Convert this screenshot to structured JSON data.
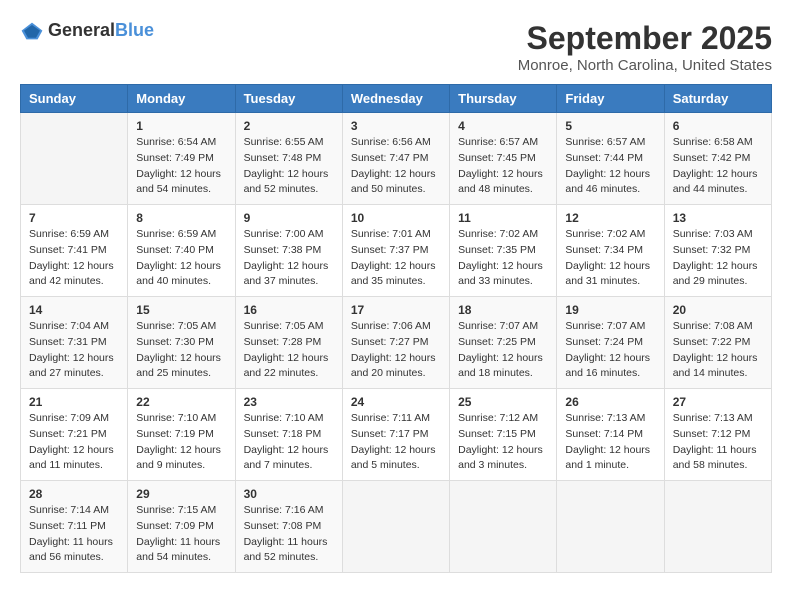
{
  "header": {
    "logo_general": "General",
    "logo_blue": "Blue",
    "month_title": "September 2025",
    "location": "Monroe, North Carolina, United States"
  },
  "weekdays": [
    "Sunday",
    "Monday",
    "Tuesday",
    "Wednesday",
    "Thursday",
    "Friday",
    "Saturday"
  ],
  "weeks": [
    [
      {
        "day": "",
        "sunrise": "",
        "sunset": "",
        "daylight": ""
      },
      {
        "day": "1",
        "sunrise": "Sunrise: 6:54 AM",
        "sunset": "Sunset: 7:49 PM",
        "daylight": "Daylight: 12 hours and 54 minutes."
      },
      {
        "day": "2",
        "sunrise": "Sunrise: 6:55 AM",
        "sunset": "Sunset: 7:48 PM",
        "daylight": "Daylight: 12 hours and 52 minutes."
      },
      {
        "day": "3",
        "sunrise": "Sunrise: 6:56 AM",
        "sunset": "Sunset: 7:47 PM",
        "daylight": "Daylight: 12 hours and 50 minutes."
      },
      {
        "day": "4",
        "sunrise": "Sunrise: 6:57 AM",
        "sunset": "Sunset: 7:45 PM",
        "daylight": "Daylight: 12 hours and 48 minutes."
      },
      {
        "day": "5",
        "sunrise": "Sunrise: 6:57 AM",
        "sunset": "Sunset: 7:44 PM",
        "daylight": "Daylight: 12 hours and 46 minutes."
      },
      {
        "day": "6",
        "sunrise": "Sunrise: 6:58 AM",
        "sunset": "Sunset: 7:42 PM",
        "daylight": "Daylight: 12 hours and 44 minutes."
      }
    ],
    [
      {
        "day": "7",
        "sunrise": "Sunrise: 6:59 AM",
        "sunset": "Sunset: 7:41 PM",
        "daylight": "Daylight: 12 hours and 42 minutes."
      },
      {
        "day": "8",
        "sunrise": "Sunrise: 6:59 AM",
        "sunset": "Sunset: 7:40 PM",
        "daylight": "Daylight: 12 hours and 40 minutes."
      },
      {
        "day": "9",
        "sunrise": "Sunrise: 7:00 AM",
        "sunset": "Sunset: 7:38 PM",
        "daylight": "Daylight: 12 hours and 37 minutes."
      },
      {
        "day": "10",
        "sunrise": "Sunrise: 7:01 AM",
        "sunset": "Sunset: 7:37 PM",
        "daylight": "Daylight: 12 hours and 35 minutes."
      },
      {
        "day": "11",
        "sunrise": "Sunrise: 7:02 AM",
        "sunset": "Sunset: 7:35 PM",
        "daylight": "Daylight: 12 hours and 33 minutes."
      },
      {
        "day": "12",
        "sunrise": "Sunrise: 7:02 AM",
        "sunset": "Sunset: 7:34 PM",
        "daylight": "Daylight: 12 hours and 31 minutes."
      },
      {
        "day": "13",
        "sunrise": "Sunrise: 7:03 AM",
        "sunset": "Sunset: 7:32 PM",
        "daylight": "Daylight: 12 hours and 29 minutes."
      }
    ],
    [
      {
        "day": "14",
        "sunrise": "Sunrise: 7:04 AM",
        "sunset": "Sunset: 7:31 PM",
        "daylight": "Daylight: 12 hours and 27 minutes."
      },
      {
        "day": "15",
        "sunrise": "Sunrise: 7:05 AM",
        "sunset": "Sunset: 7:30 PM",
        "daylight": "Daylight: 12 hours and 25 minutes."
      },
      {
        "day": "16",
        "sunrise": "Sunrise: 7:05 AM",
        "sunset": "Sunset: 7:28 PM",
        "daylight": "Daylight: 12 hours and 22 minutes."
      },
      {
        "day": "17",
        "sunrise": "Sunrise: 7:06 AM",
        "sunset": "Sunset: 7:27 PM",
        "daylight": "Daylight: 12 hours and 20 minutes."
      },
      {
        "day": "18",
        "sunrise": "Sunrise: 7:07 AM",
        "sunset": "Sunset: 7:25 PM",
        "daylight": "Daylight: 12 hours and 18 minutes."
      },
      {
        "day": "19",
        "sunrise": "Sunrise: 7:07 AM",
        "sunset": "Sunset: 7:24 PM",
        "daylight": "Daylight: 12 hours and 16 minutes."
      },
      {
        "day": "20",
        "sunrise": "Sunrise: 7:08 AM",
        "sunset": "Sunset: 7:22 PM",
        "daylight": "Daylight: 12 hours and 14 minutes."
      }
    ],
    [
      {
        "day": "21",
        "sunrise": "Sunrise: 7:09 AM",
        "sunset": "Sunset: 7:21 PM",
        "daylight": "Daylight: 12 hours and 11 minutes."
      },
      {
        "day": "22",
        "sunrise": "Sunrise: 7:10 AM",
        "sunset": "Sunset: 7:19 PM",
        "daylight": "Daylight: 12 hours and 9 minutes."
      },
      {
        "day": "23",
        "sunrise": "Sunrise: 7:10 AM",
        "sunset": "Sunset: 7:18 PM",
        "daylight": "Daylight: 12 hours and 7 minutes."
      },
      {
        "day": "24",
        "sunrise": "Sunrise: 7:11 AM",
        "sunset": "Sunset: 7:17 PM",
        "daylight": "Daylight: 12 hours and 5 minutes."
      },
      {
        "day": "25",
        "sunrise": "Sunrise: 7:12 AM",
        "sunset": "Sunset: 7:15 PM",
        "daylight": "Daylight: 12 hours and 3 minutes."
      },
      {
        "day": "26",
        "sunrise": "Sunrise: 7:13 AM",
        "sunset": "Sunset: 7:14 PM",
        "daylight": "Daylight: 12 hours and 1 minute."
      },
      {
        "day": "27",
        "sunrise": "Sunrise: 7:13 AM",
        "sunset": "Sunset: 7:12 PM",
        "daylight": "Daylight: 11 hours and 58 minutes."
      }
    ],
    [
      {
        "day": "28",
        "sunrise": "Sunrise: 7:14 AM",
        "sunset": "Sunset: 7:11 PM",
        "daylight": "Daylight: 11 hours and 56 minutes."
      },
      {
        "day": "29",
        "sunrise": "Sunrise: 7:15 AM",
        "sunset": "Sunset: 7:09 PM",
        "daylight": "Daylight: 11 hours and 54 minutes."
      },
      {
        "day": "30",
        "sunrise": "Sunrise: 7:16 AM",
        "sunset": "Sunset: 7:08 PM",
        "daylight": "Daylight: 11 hours and 52 minutes."
      },
      {
        "day": "",
        "sunrise": "",
        "sunset": "",
        "daylight": ""
      },
      {
        "day": "",
        "sunrise": "",
        "sunset": "",
        "daylight": ""
      },
      {
        "day": "",
        "sunrise": "",
        "sunset": "",
        "daylight": ""
      },
      {
        "day": "",
        "sunrise": "",
        "sunset": "",
        "daylight": ""
      }
    ]
  ]
}
